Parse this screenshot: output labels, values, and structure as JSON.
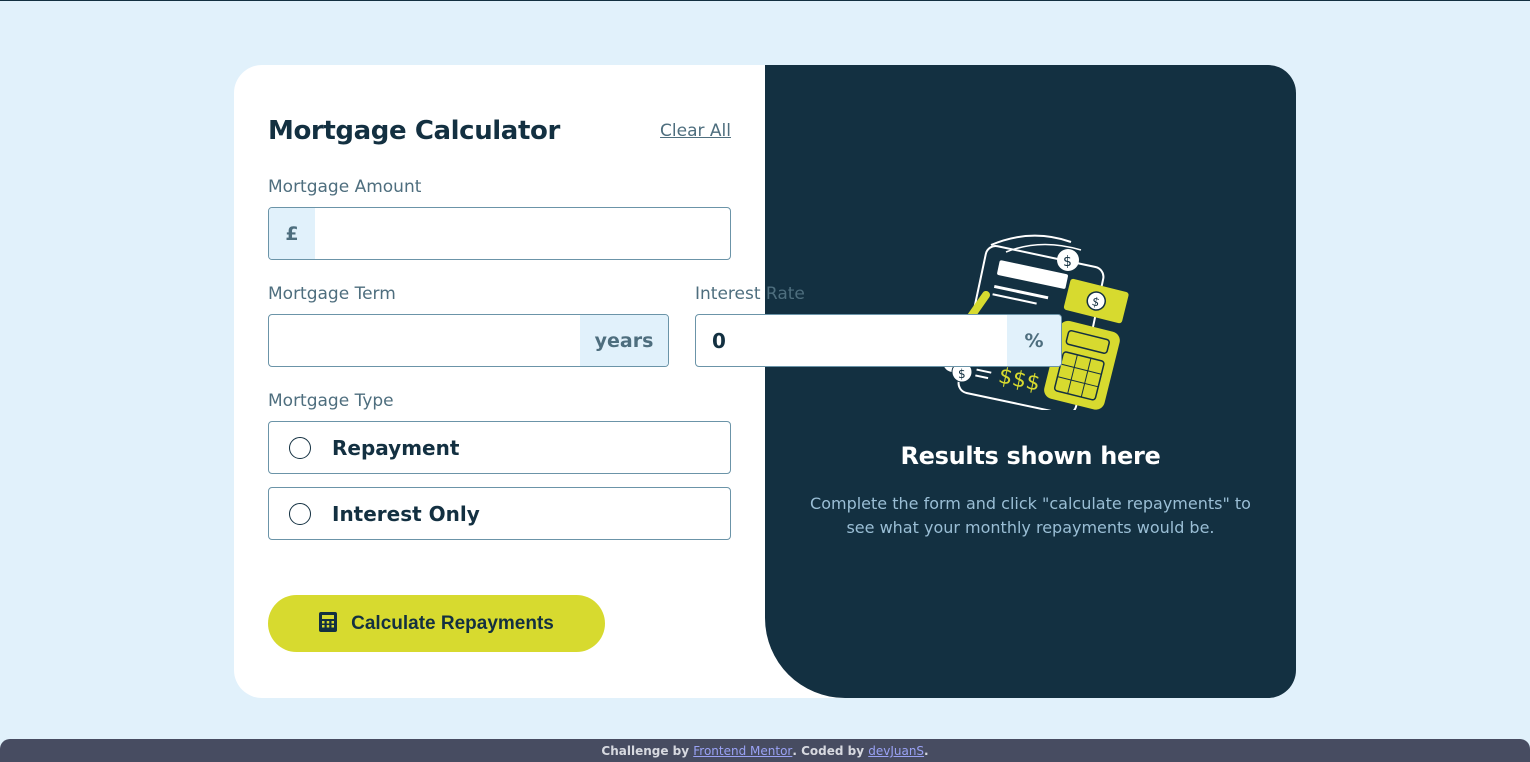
{
  "form": {
    "title": "Mortgage Calculator",
    "clear_label": "Clear All",
    "amount": {
      "label": "Mortgage Amount",
      "prefix": "£",
      "value": ""
    },
    "term": {
      "label": "Mortgage Term",
      "suffix": "years",
      "value": ""
    },
    "rate": {
      "label": "Interest Rate",
      "suffix": "%",
      "value": "0"
    },
    "type": {
      "label": "Mortgage Type",
      "options": [
        {
          "label": "Repayment",
          "selected": false
        },
        {
          "label": "Interest Only",
          "selected": false
        }
      ]
    },
    "submit_label": "Calculate Repayments"
  },
  "results": {
    "title": "Results shown here",
    "description": "Complete the form and click \"calculate repayments\" to see what your monthly repayments would be."
  },
  "footer": {
    "prefix": "Challenge by ",
    "link1": "Frontend Mentor",
    "middle": ". Coded by ",
    "link2": "devJuanS",
    "suffix": "."
  },
  "colors": {
    "background": "#e1f1fb",
    "accent": "#d7da2f",
    "dark": "#133041",
    "muted": "#4e6e7e"
  }
}
